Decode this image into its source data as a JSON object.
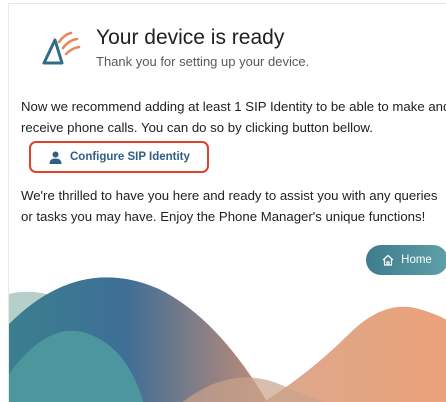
{
  "header": {
    "title": "Your device is ready",
    "subtitle": "Thank you for setting up your device."
  },
  "body": {
    "recommendation": "Now we recommend adding at least 1 SIP Identity to be able to make and receive phone calls. You can do so by clicking button bellow.",
    "welcome": "We're thrilled to have you here and ready to assist you with any queries or tasks you may have. Enjoy the Phone Manager's unique functions!"
  },
  "actions": {
    "configure_label": "Configure SIP Identity",
    "configure_icon": "person-icon",
    "home_label": "Home",
    "home_icon": "home-icon"
  },
  "colors": {
    "accent": "#2f5f86",
    "highlight_border": "#e0412c",
    "home_button": "#4a8a96"
  }
}
